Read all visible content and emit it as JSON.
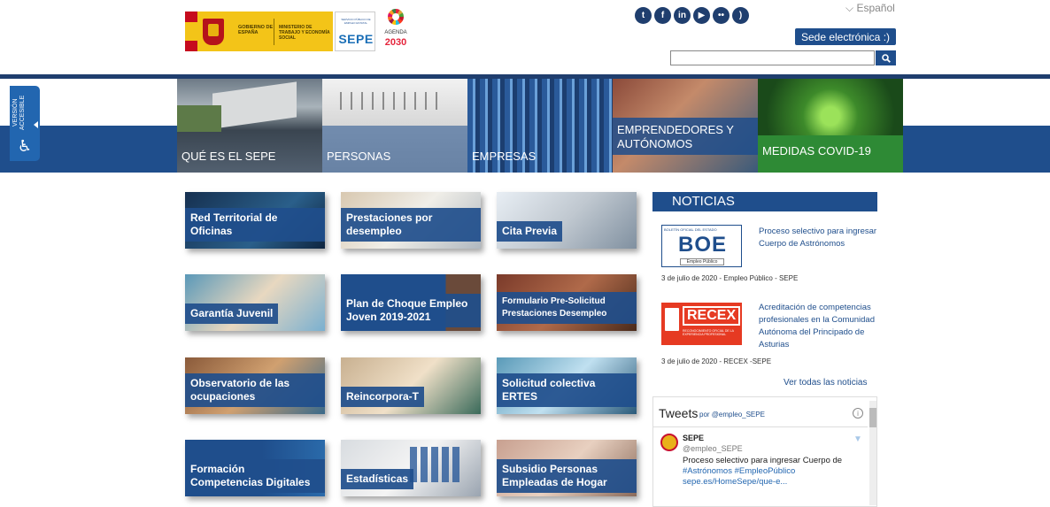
{
  "header": {
    "gov_text": "GOBIERNO DE ESPAÑA",
    "ministry_text": "MINISTERIO DE TRABAJO Y ECONOMÍA SOCIAL",
    "sepe_small": "SERVICIO PÚBLICO DE EMPLEO ESTATAL",
    "sepe_big": "SEPE",
    "agenda_label": "AGENDA",
    "agenda_year": "2030",
    "language": "Español",
    "sede_button": "Sede electrónica :)",
    "search_value": "",
    "social": [
      "twitter",
      "facebook",
      "linkedin",
      "youtube",
      "flickr",
      "rss"
    ]
  },
  "accessible": {
    "label": "VERSIÓN ACCESIBLE"
  },
  "nav": [
    {
      "label": "QUÉ ES EL SEPE"
    },
    {
      "label": "PERSONAS"
    },
    {
      "label": "EMPRESAS"
    },
    {
      "label": "EMPRENDEDORES Y AUTÓNOMOS"
    },
    {
      "label": "MEDIDAS COVID-19"
    }
  ],
  "tiles": [
    {
      "label": "Red Territorial de Oficinas"
    },
    {
      "label": "Prestaciones por desempleo"
    },
    {
      "label": "Cita Previa"
    },
    {
      "label": "Garantía Juvenil"
    },
    {
      "label": "Plan de Choque Empleo Joven 2019-2021"
    },
    {
      "label": "Formulario Pre-Solicitud Prestaciones Desempleo"
    },
    {
      "label": "Observatorio de las ocupaciones"
    },
    {
      "label": "Reincorpora-T"
    },
    {
      "label": "Solicitud colectiva ERTES"
    },
    {
      "label": "Formación Competencias Digitales"
    },
    {
      "label": "Estadísticas"
    },
    {
      "label": "Subsidio Personas Empleadas de Hogar"
    }
  ],
  "news": {
    "title": "NOTICIAS",
    "items": [
      {
        "image_text": "BOE",
        "image_caption": "BOLETÍN OFICIAL DEL ESTADO",
        "image_sub": "Empleo Público",
        "text": "Proceso selectivo para ingresar Cuerpo de Astrónomos",
        "date": "3 de julio de 2020 - Empleo Público - SEPE"
      },
      {
        "image_text": "RECEX",
        "image_caption": "RECONOCIMIENTO OFICIAL DE LA EXPERIENCIA PROFESIONAL",
        "text": "Acreditación de competencias profesionales en la Comunidad Autónoma del Principado de Asturias",
        "date": "3 de julio de 2020 - RECEX -SEPE"
      }
    ],
    "see_all": "Ver todas las noticias"
  },
  "tweets": {
    "header": "Tweets",
    "by": "por @empleo_SEPE",
    "name": "SEPE",
    "handle": "@empleo_SEPE",
    "text": "Proceso selectivo para ingresar Cuerpo de",
    "hashtags": "#Astrónomos #EmpleoPúblico",
    "link": "sepe.es/HomeSepe/que-e..."
  }
}
